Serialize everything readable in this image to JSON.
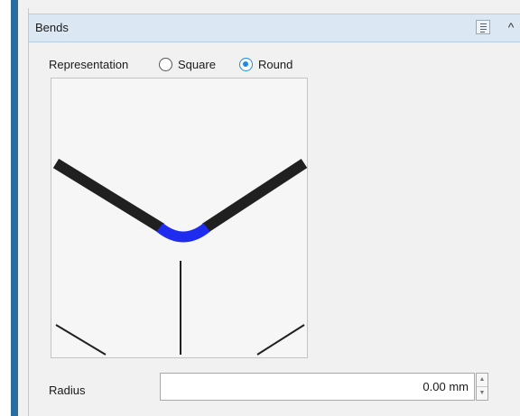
{
  "panel": {
    "title": "Bends",
    "icons": {
      "properties": "properties-list-icon",
      "collapse": "chevron-up-icon"
    }
  },
  "representation": {
    "label": "Representation",
    "options": [
      {
        "label": "Square",
        "selected": false
      },
      {
        "label": "Round",
        "selected": true
      }
    ]
  },
  "radius": {
    "label": "Radius",
    "value": "0.00 mm"
  },
  "colors": {
    "accent": "#1a8ce6",
    "bend_highlight": "#1f2cf0",
    "header_bg": "#dbe8f4",
    "side_bar": "#2b6d9e"
  }
}
